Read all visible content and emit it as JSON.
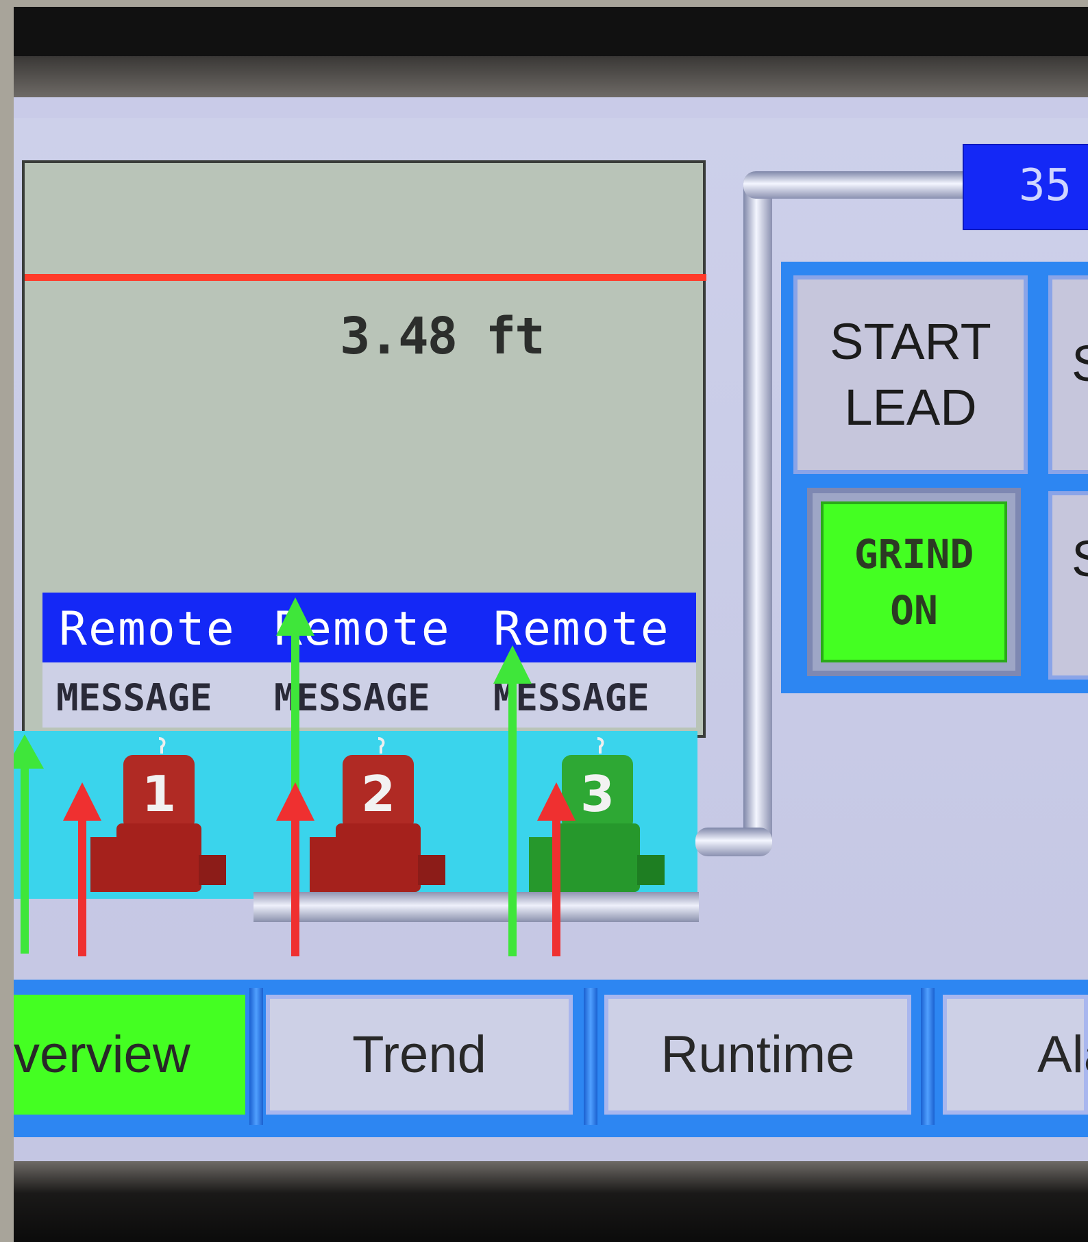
{
  "well": {
    "level_reading": "3.48 ft",
    "remote_labels": [
      "Remote",
      "Remote",
      "Remote"
    ],
    "message_labels": [
      "MESSAGE",
      "MESSAGE",
      "MESSAGE"
    ]
  },
  "pumps": [
    {
      "number": "1",
      "state": "stopped",
      "color": "#b02a24"
    },
    {
      "number": "2",
      "state": "stopped",
      "color": "#b02a24"
    },
    {
      "number": "3",
      "state": "running",
      "color": "#2ea834"
    }
  ],
  "discharge": {
    "flow_value": "35"
  },
  "controls": {
    "start_lead_line1": "START",
    "start_lead_line2": "LEAD",
    "grind_line1": "GRIND",
    "grind_line2": "ON",
    "partial_label_top": "S",
    "partial_label_bottom": "S"
  },
  "tabs": [
    {
      "label": "verview",
      "active": true
    },
    {
      "label": "Trend",
      "active": false
    },
    {
      "label": "Runtime",
      "active": false
    },
    {
      "label": "Ala",
      "active": false
    }
  ],
  "colors": {
    "active_tab": "#44ff22",
    "grind_on": "#44ff22",
    "level_line": "#ff3b2a",
    "water": "#3ad4ec",
    "remote_bar": "#1428f6",
    "running_arrow": "#3fe63a",
    "stopped_arrow": "#ef3030"
  }
}
